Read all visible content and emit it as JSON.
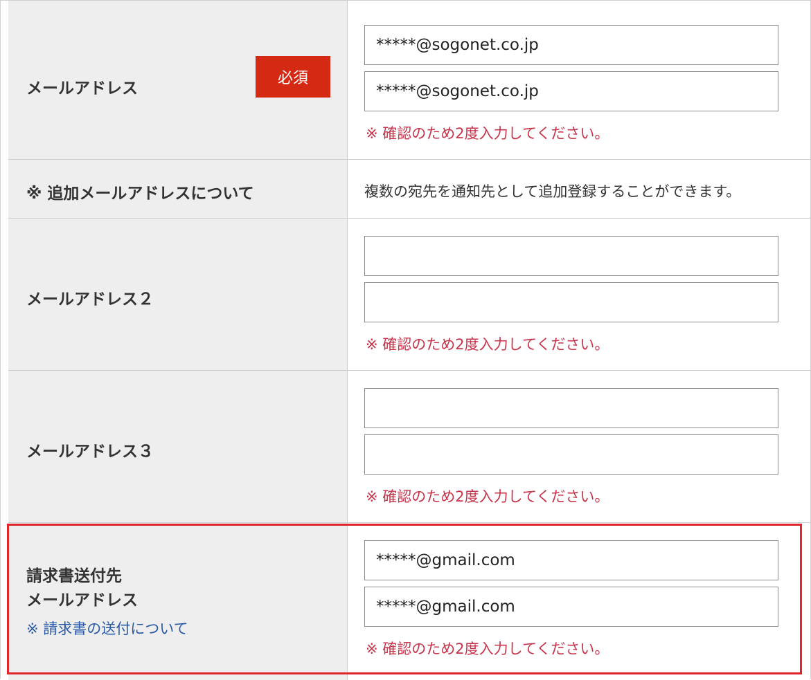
{
  "rows": {
    "email": {
      "label": "メールアドレス",
      "required_badge": "必須",
      "input1_value": "*****@sogonet.co.jp",
      "input2_value": "*****@sogonet.co.jp",
      "note": "※ 確認のため2度入力してください。"
    },
    "additional": {
      "label": "※ 追加メールアドレスについて",
      "info": "複数の宛先を通知先として追加登録することができます。"
    },
    "email2": {
      "label": "メールアドレス２",
      "input1_value": "",
      "input2_value": "",
      "note": "※ 確認のため2度入力してください。"
    },
    "email3": {
      "label": "メールアドレス３",
      "input1_value": "",
      "input2_value": "",
      "note": "※ 確認のため2度入力してください。"
    },
    "invoice": {
      "label_line1": "請求書送付先",
      "label_line2": "メールアドレス",
      "link": "※ 請求書の送付について",
      "input1_value": "*****@gmail.com",
      "input2_value": "*****@gmail.com",
      "note": "※ 確認のため2度入力してください。"
    }
  },
  "colors": {
    "required_badge": "#d42a14",
    "note_text": "#c8334a",
    "link_text": "#2a5aa8",
    "highlight_border": "#e0242c"
  }
}
